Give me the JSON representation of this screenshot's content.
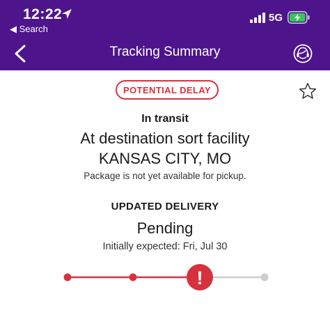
{
  "status_bar": {
    "time": "12:22",
    "back_to_app": "◀ Search",
    "network": "5G"
  },
  "header": {
    "title": "Tracking Summary"
  },
  "tracking": {
    "badge": "POTENTIAL DELAY",
    "status_label": "In transit",
    "status_detail": "At destination sort facility",
    "location": "KANSAS CITY, MO",
    "pickup_note": "Package is not yet available for pickup.",
    "delivery_label": "UPDATED DELIVERY",
    "delivery_status": "Pending",
    "expected": "Initially expected: Fri, Jul 30"
  },
  "progress": {
    "completed_steps": 2,
    "alert_step": 3,
    "total_steps": 4,
    "alert_glyph": "!"
  },
  "colors": {
    "header_bg": "#4d148c",
    "alert_red": "#d6323e",
    "inactive_gray": "#cccccc",
    "battery_green": "#34c759"
  },
  "icons": {
    "location": "location-arrow-icon",
    "signal": "cellular-signal-icon",
    "battery": "battery-charging-icon",
    "back": "chevron-left-icon",
    "support": "support-headset-icon",
    "favorite": "star-outline-icon",
    "alert": "exclamation-icon"
  }
}
